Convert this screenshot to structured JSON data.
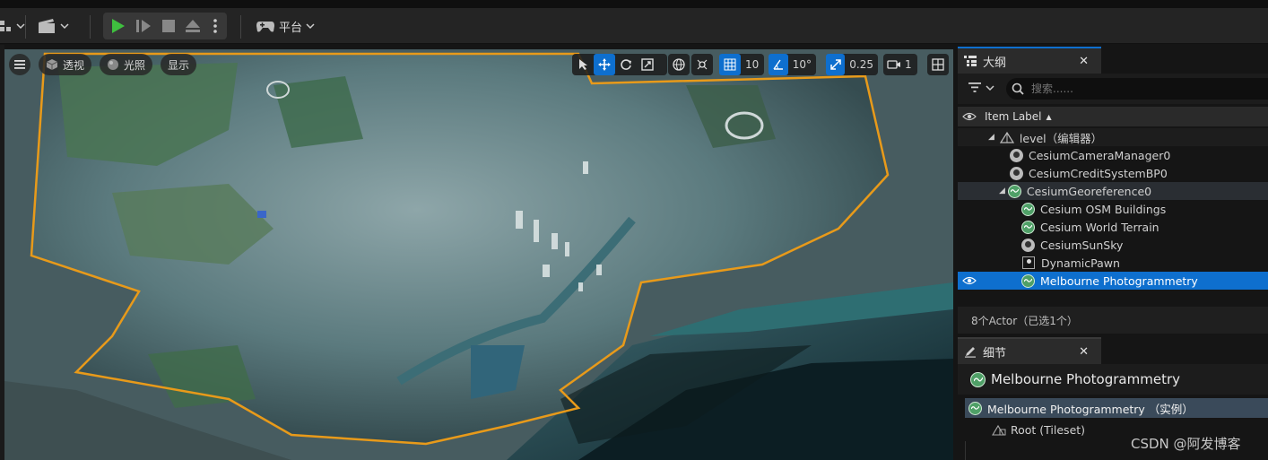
{
  "toolbar": {
    "platform_label": "平台"
  },
  "viewport": {
    "perspective_label": "透视",
    "lighting_label": "光照",
    "show_label": "显示",
    "grid_snap": "10",
    "rotation_snap": "10°",
    "scale_snap": "0.25",
    "camera_speed": "1"
  },
  "outliner": {
    "tab_title": "大纲",
    "search_placeholder": "搜索......",
    "column_label": "Item Label",
    "items": [
      {
        "label": "level（编辑器）",
        "icon": "level-icon"
      },
      {
        "label": "CesiumCameraManager0",
        "icon": "actor-icon"
      },
      {
        "label": "CesiumCreditSystemBP0",
        "icon": "actor-icon"
      },
      {
        "label": "CesiumGeoreference0",
        "icon": "globe-icon"
      },
      {
        "label": "Cesium OSM Buildings",
        "icon": "globe-icon"
      },
      {
        "label": "Cesium World Terrain",
        "icon": "globe-icon"
      },
      {
        "label": "CesiumSunSky",
        "icon": "actor-icon"
      },
      {
        "label": "DynamicPawn",
        "icon": "pawn-icon"
      },
      {
        "label": "Melbourne Photogrammetry",
        "icon": "globe-icon"
      }
    ],
    "status": "8个Actor（已选1个）"
  },
  "details": {
    "tab_title": "细节",
    "object_title": "Melbourne Photogrammetry",
    "instance_label": "Melbourne Photogrammetry （实例）",
    "root_label": "Root (Tileset)"
  },
  "watermark": "CSDN @阿发博客",
  "colors": {
    "accent": "#0e6fce",
    "selection_outline": "#e89a1a",
    "play_green": "#3fbf3f"
  }
}
